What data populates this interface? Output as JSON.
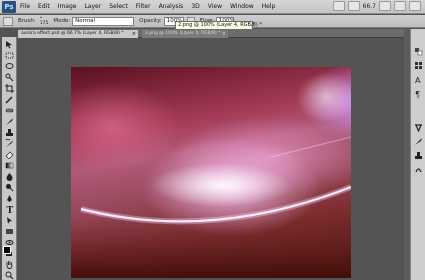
{
  "app": {
    "logo": "Ps",
    "zoom_readout": "66.7"
  },
  "menu": {
    "items": [
      "File",
      "Edit",
      "Image",
      "Layer",
      "Select",
      "Filter",
      "Analysis",
      "3D",
      "View",
      "Window",
      "Help"
    ]
  },
  "options_bar": {
    "brush_label": "Brush:",
    "brush_size": "175",
    "mode_label": "Mode:",
    "mode_value": "Normal",
    "opacity_label": "Opacity:",
    "opacity_value": "100%",
    "flow_label": "Flow:",
    "flow_value": "100%"
  },
  "tooltip": {
    "text": "2.png @ 100% (Layer 4, RGB/8) *"
  },
  "tabs": [
    {
      "label": "aurora effect.psd @ 66.7% (Layer 4, RGB/8) *",
      "active": true
    },
    {
      "label": "2.png @ 100% (Layer 4, RGB/8) *",
      "active": false
    }
  ],
  "icons": {
    "tools": [
      "move-icon",
      "marquee-icon",
      "lasso-icon",
      "quick-select-icon",
      "crop-icon",
      "eyedropper-icon",
      "healing-icon",
      "brush-icon",
      "stamp-icon",
      "history-brush-icon",
      "eraser-icon",
      "gradient-icon",
      "blur-icon",
      "dodge-icon",
      "pen-icon",
      "type-icon",
      "path-select-icon",
      "shape-icon",
      "3d-rotate-icon",
      "3d-camera-icon",
      "hand-icon",
      "zoom-icon"
    ],
    "dock": [
      "color-panel-icon",
      "swatches-icon",
      "styles-icon",
      "adjustments-icon",
      "masks-icon",
      "layers-icon",
      "channels-icon",
      "paths-icon"
    ]
  },
  "colors": {
    "foreground": "#000000",
    "background": "#ffffff"
  }
}
